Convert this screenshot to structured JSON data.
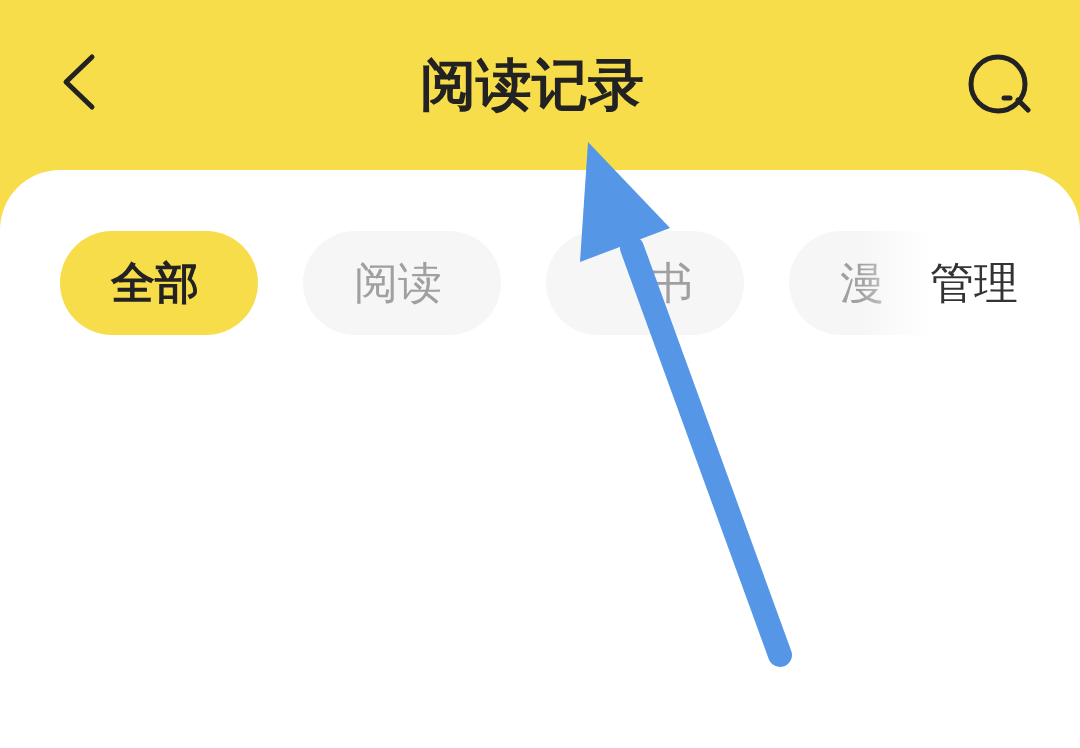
{
  "header": {
    "title": "阅读记录"
  },
  "tabs": [
    {
      "label": "全部",
      "selected": true,
      "kind": "plain"
    },
    {
      "label": "阅读",
      "selected": false,
      "kind": "plain"
    },
    {
      "label": "书",
      "selected": false,
      "kind": "covered"
    },
    {
      "label": "漫",
      "selected": false,
      "kind": "plain"
    }
  ],
  "manage_button": {
    "label": "管理"
  },
  "annotation": {
    "kind": "arrow"
  }
}
